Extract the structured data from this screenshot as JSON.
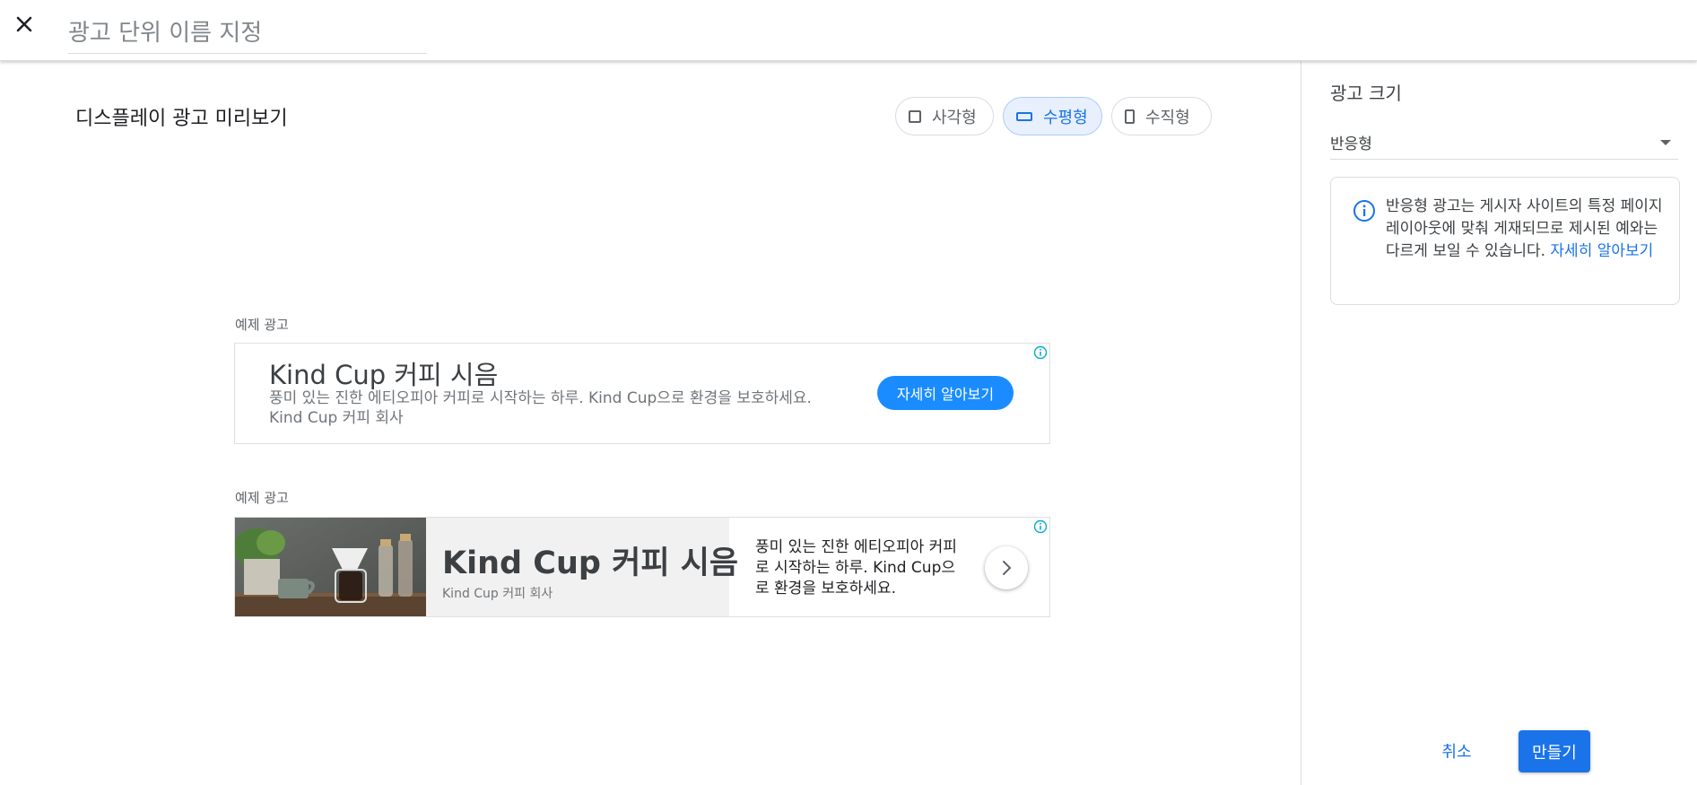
{
  "header": {
    "name_placeholder": "광고 단위 이름 지정"
  },
  "preview": {
    "title": "디스플레이 광고 미리보기",
    "toggles": [
      {
        "label": "사각형",
        "active": false
      },
      {
        "label": "수평형",
        "active": true
      },
      {
        "label": "수직형",
        "active": false
      }
    ],
    "example_label": "예제 광고",
    "ad1": {
      "headline": "Kind Cup 커피 시음",
      "description": "풍미 있는 진한 에티오피아 커피로 시작하는 하루. Kind Cup으로 환경을 보호하세요. Kind Cup 커피 회사",
      "cta": "자세히 알아보기"
    },
    "ad2": {
      "headline": "Kind Cup 커피 시음",
      "advertiser": "Kind Cup 커피 회사",
      "description": "풍미 있는 진한 에티오피아 커피로 시작하는 하루. Kind Cup으로 환경을 보호하세요."
    }
  },
  "side_panel": {
    "title": "광고 크기",
    "size_value": "반응형",
    "info_text": "반응형 광고는 게시자 사이트의 특정 페이지 레이아웃에 맞춰 게재되므로 제시된 예와는 다르게 보일 수 있습니다.",
    "info_link": "자세히 알아보기",
    "cancel_label": "취소",
    "create_label": "만들기"
  },
  "colors": {
    "accent": "#1a73e8",
    "cta_blue": "#1a8cff",
    "adchoice_teal": "#00aecd"
  }
}
